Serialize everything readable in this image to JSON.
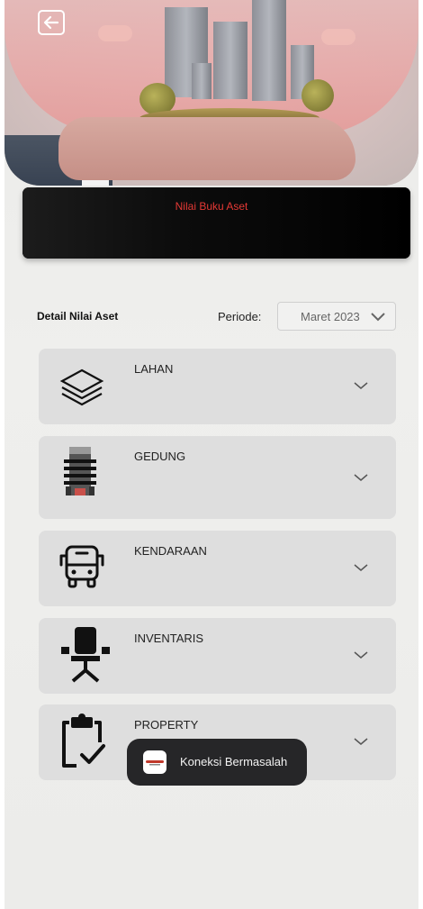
{
  "header": {
    "back_icon": "arrow-left-icon",
    "value_title": "Nilai Buku Aset"
  },
  "detail": {
    "label": "Detail Nilai Aset",
    "periode_label": "Periode:",
    "periode_value": "Maret 2023"
  },
  "categories": [
    {
      "label": "LAHAN",
      "icon": "layers-icon"
    },
    {
      "label": "GEDUNG",
      "icon": "building-icon"
    },
    {
      "label": "KENDARAAN",
      "icon": "bus-icon"
    },
    {
      "label": "INVENTARIS",
      "icon": "office-chair-icon"
    },
    {
      "label": "PROPERTY",
      "icon": "clipboard-check-icon"
    }
  ],
  "toast": {
    "text": "Koneksi Bermasalah"
  },
  "colors": {
    "value_title": "#e53935",
    "card_bg": "#dedede",
    "toast_bg": "#262628"
  }
}
